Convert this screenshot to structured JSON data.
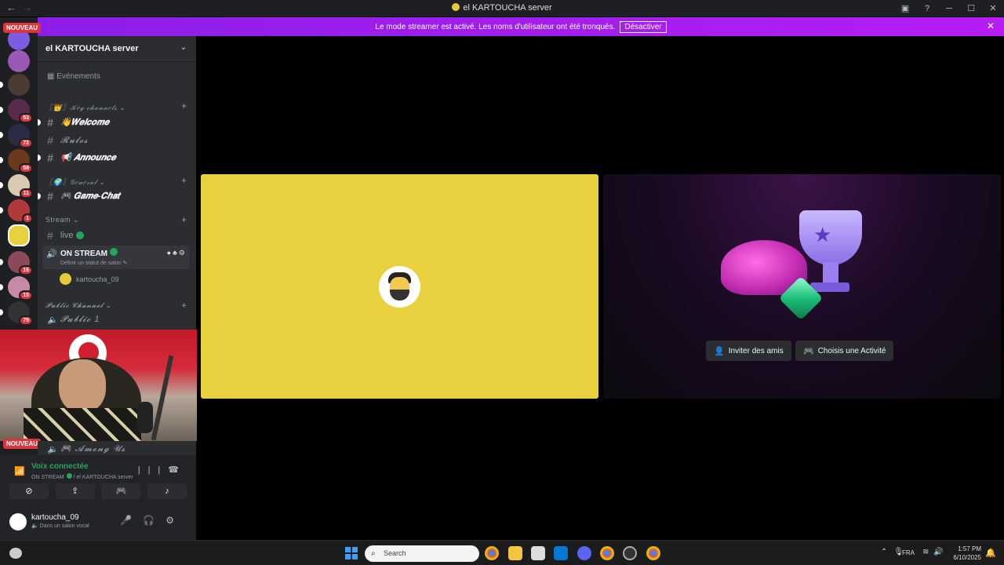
{
  "window": {
    "title": "el KARTOUCHA server"
  },
  "banner": {
    "message": "Le mode streamer est activé. Les noms d'utilisateur ont été tronqués.",
    "action": "Désactiver"
  },
  "badges": {
    "nouveau_top": "NOUVEAU",
    "nouveau_bottom": "NOUVEAU"
  },
  "servers": [
    {
      "badge": ""
    },
    {
      "badge": ""
    },
    {
      "badge": ""
    },
    {
      "badge": "53"
    },
    {
      "badge": "72"
    },
    {
      "badge": "59"
    },
    {
      "badge": "11"
    },
    {
      "badge": "1"
    },
    {
      "badge": ""
    },
    {
      "badge": "16"
    },
    {
      "badge": "15"
    },
    {
      "badge": "79"
    }
  ],
  "sidebar": {
    "server_name": "el KARTOUCHA server",
    "events": "Evénements",
    "categories": {
      "key": "〖👑〗𝒦𝑒𝓎 𝒸𝒽𝒶𝓃𝓃𝑒𝓁𝓈",
      "general": "〖🌍〗𝒢𝑒𝓃𝑒𝓇𝒶𝓁",
      "stream": "Stream",
      "public": "𝓟𝓾𝓫𝓵𝓲𝓬 𝓒𝓱𝓪𝓷𝓷𝓮𝓵"
    },
    "channels": {
      "welcome": "👋𝑾𝒆𝒍𝒄𝒐𝒎𝒆",
      "rules": "𝓡𝓾𝓵𝓮𝓼",
      "announce": "📢 𝑨𝒏𝒏𝒐𝒖𝒏𝒄𝒆",
      "gamechat": "🎮 𝑮𝒂𝒎𝒆-𝑪𝒉𝒂𝒕",
      "live": "live",
      "onstream": "ON STREAM",
      "onstream_status": "Définir un statut de salon",
      "public1": "𝓟𝓾𝓫𝓵𝓲𝓬 1",
      "amongus": "🎮 𝓐𝓶𝓸𝓷𝓰 𝓤𝓼"
    },
    "voice_user": "kartoucha_09"
  },
  "voice_panel": {
    "title": "Voix connectée",
    "channel": "ON STREAM",
    "server": " / el KARTOUCHA server"
  },
  "user": {
    "name": "kartoucha_09",
    "status": "Dans un salon vocal"
  },
  "activity": {
    "invite": "Inviter des amis",
    "choose": "Choisis une Activité"
  },
  "taskbar": {
    "search_placeholder": "Search",
    "lang": "FRA",
    "time": "1:57 PM",
    "date": "6/10/2025"
  },
  "colors": {
    "banner": "#a11ef5",
    "tile_yellow": "#e8d03f",
    "green": "#23a55a",
    "red_badge": "#da373c"
  }
}
